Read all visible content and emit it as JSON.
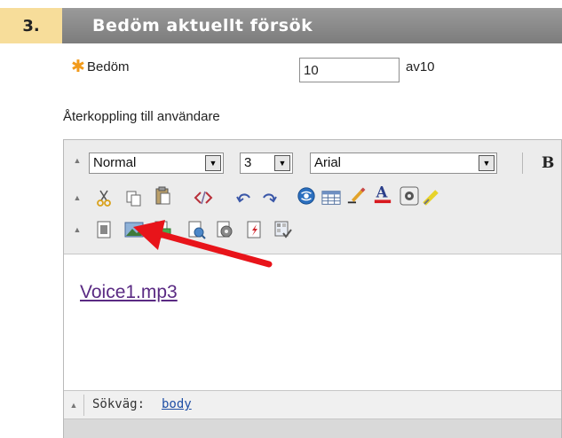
{
  "section": {
    "number": "3.",
    "title": "Bedöm aktuellt försök"
  },
  "grade": {
    "required_icon": "asterisk-icon",
    "label": "Bedöm",
    "value": "10",
    "of_label": "av10"
  },
  "feedback": {
    "label": "Återkoppling till användare"
  },
  "editor": {
    "toolbar": {
      "format_select": "Normal",
      "size_select": "3",
      "font_select": "Arial",
      "bold_label": "B",
      "row2_icons": [
        "cut-icon",
        "copy-icon",
        "paste-icon",
        "html-code-icon",
        "undo-icon",
        "redo-icon",
        "link-globe-icon",
        "table-icon",
        "pencil-icon",
        "font-color-icon",
        "special-char-icon",
        "highlighter-icon"
      ],
      "row3_icons": [
        "mashup-icon",
        "image-icon",
        "insert-file-icon",
        "preview-icon",
        "audio-icon",
        "flash-icon",
        "spellcheck-icon"
      ]
    },
    "content": {
      "link_text": "Voice1.mp3"
    },
    "path": {
      "label": "Sökväg:",
      "value": "body"
    }
  },
  "colors": {
    "header_bar": "#8a8a8a",
    "step_badge": "#f7dd9a",
    "required_star": "#f29a1a",
    "link": "#5a2a83",
    "annotation_arrow": "#e8141a"
  }
}
